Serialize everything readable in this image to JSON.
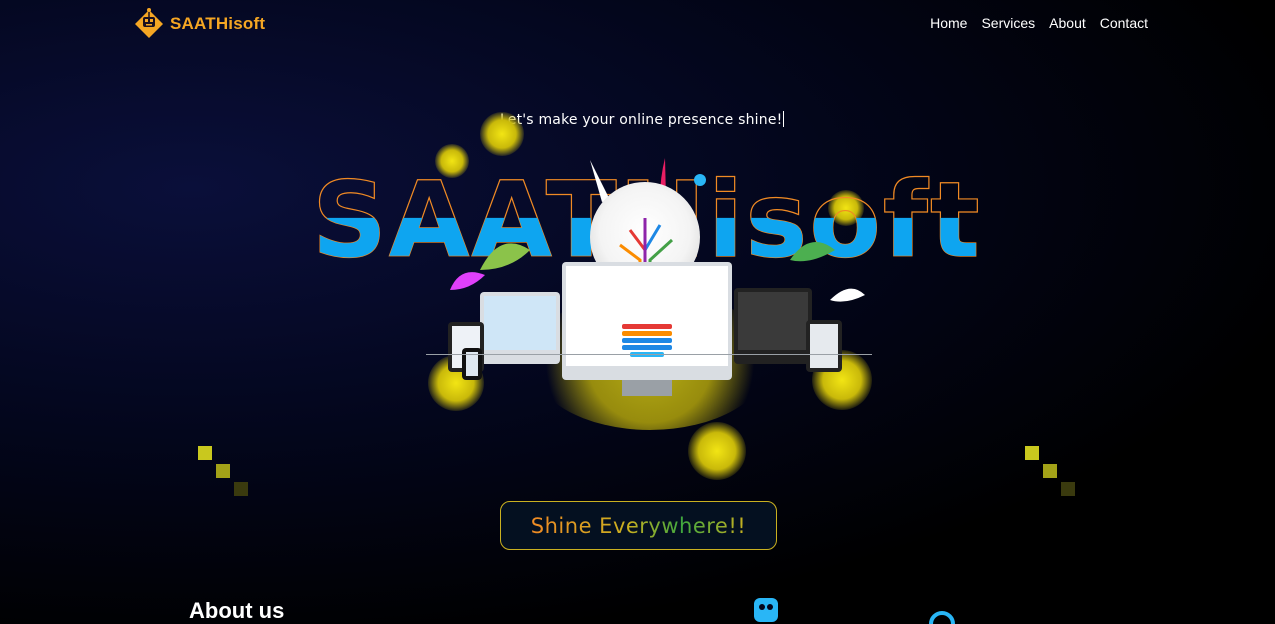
{
  "brand": {
    "name": "SAATHisoft",
    "logo_icon": "robot-icon"
  },
  "nav": {
    "items": [
      "Home",
      "Services",
      "About",
      "Contact"
    ]
  },
  "hero": {
    "tagline": "Let's make your online presence shine!",
    "title": "SAATHisoft",
    "cta_label": "Shine Everywhere!!"
  },
  "about": {
    "heading": "About us"
  },
  "colors": {
    "accent": "#f5a623",
    "title_blue": "#0ea5f0",
    "outline_orange": "#f08a24",
    "glow_yellow": "#f2e514"
  }
}
